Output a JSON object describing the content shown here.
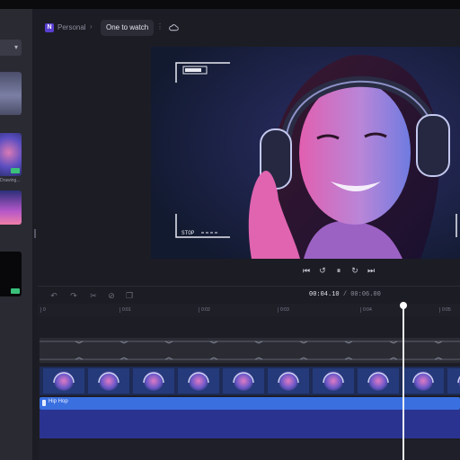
{
  "header": {
    "workspace_letter": "N",
    "workspace_name": "Personal",
    "project_title": "One to watch"
  },
  "preview": {
    "rec_indicator": "REC",
    "stop_label": "STOP"
  },
  "timeline": {
    "current_time": "00:04.10",
    "duration": "00:06.00",
    "ruler_ticks": [
      "0",
      "0:01",
      "0:02",
      "0:03",
      "0:04",
      "0:05"
    ]
  },
  "tracks": {
    "music_label": "Hip Hop"
  },
  "left_panel": {
    "thumb_caption": "Drawing..."
  },
  "colors": {
    "accent": "#3a6fe0",
    "badge": "#3ac07a"
  }
}
